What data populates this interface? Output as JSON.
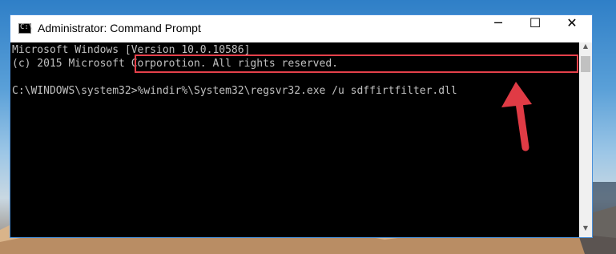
{
  "window": {
    "title": "Administrator: Command Prompt",
    "icon": "cmd-icon",
    "controls": {
      "minimize": "─",
      "maximize": "☐",
      "close": "✕"
    }
  },
  "console": {
    "line1": "Microsoft Windows [Version 10.0.10586]",
    "line2": "(c) 2015 Microsoft Corporotion. All rights reserved.",
    "prompt": "C:\\WINDOWS\\system32>",
    "command": "%windir%\\System32\\regsvr32.exe /u sdffirtfilter.dll"
  },
  "annotation": {
    "highlight_color": "#e5404a",
    "arrow": "red-arrow-icon"
  },
  "colors": {
    "console_bg": "#000000",
    "console_text": "#c0c0c0",
    "titlebar_bg": "#ffffff"
  }
}
